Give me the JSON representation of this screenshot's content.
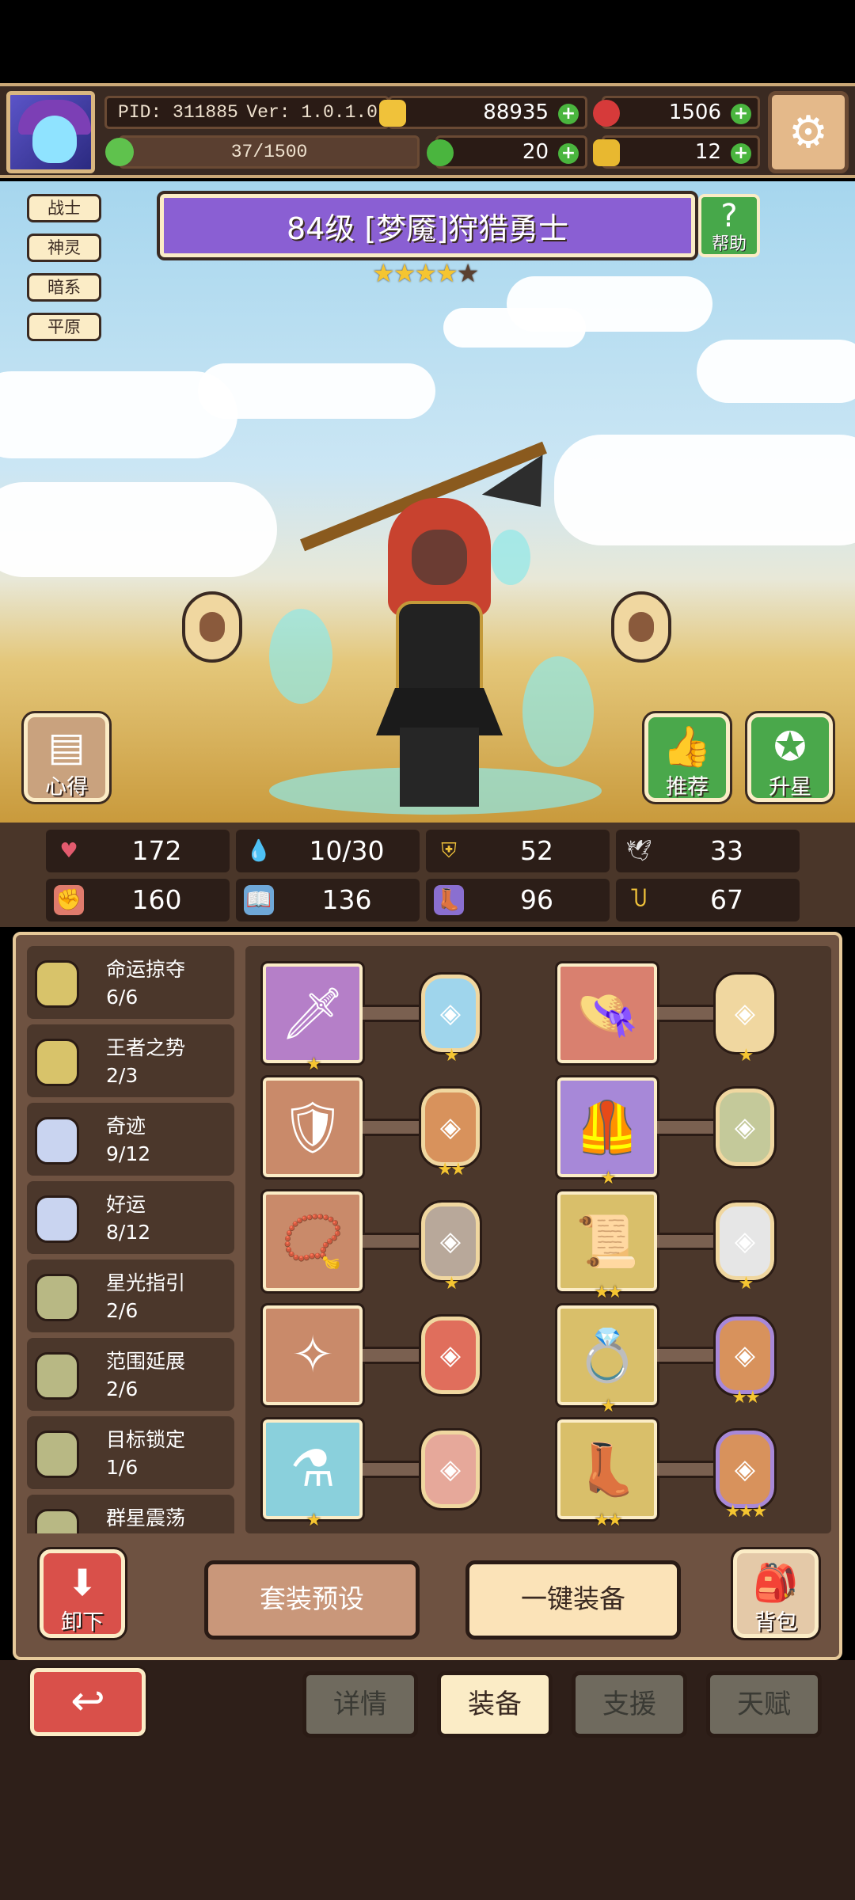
{
  "header": {
    "pid": "PID: 311885",
    "version": "Ver: 1.0.1.0",
    "gold": "88935",
    "gems": "1506",
    "stamina": "37/1500",
    "clover": "20",
    "cards": "12"
  },
  "hero": {
    "tags": [
      "战士",
      "神灵",
      "暗系",
      "平原"
    ],
    "title": "84级 [梦魇]狩猎勇士",
    "stars_filled": 4,
    "stars_total": 5,
    "help_label": "帮助",
    "insight_label": "心得",
    "recommend_label": "推荐",
    "starup_label": "升星"
  },
  "stats": [
    "172",
    "10/30",
    "52",
    "33",
    "160",
    "136",
    "96",
    "67"
  ],
  "sets": [
    {
      "name": "命运掠夺",
      "progress": "6/6",
      "color": "#d8c36a"
    },
    {
      "name": "王者之势",
      "progress": "2/3",
      "color": "#d8c36a"
    },
    {
      "name": "奇迹",
      "progress": "9/12",
      "color": "#c9d4f0"
    },
    {
      "name": "好运",
      "progress": "8/12",
      "color": "#c9d4f0"
    },
    {
      "name": "星光指引",
      "progress": "2/6",
      "color": "#b8b884"
    },
    {
      "name": "范围延展",
      "progress": "2/6",
      "color": "#b8b884"
    },
    {
      "name": "目标锁定",
      "progress": "1/6",
      "color": "#b8b884"
    },
    {
      "name": "群星震荡",
      "progress": "",
      "color": "#b8b884"
    }
  ],
  "actions": {
    "unequip": "卸下",
    "preset": "套装预设",
    "equip_all": "一键装备",
    "backpack": "背包"
  },
  "tabs": {
    "details": "详情",
    "equipment": "装备",
    "support": "支援",
    "talent": "天赋"
  },
  "colors": {
    "accent_green": "#4ab53e",
    "title_purple": "#8a5fd3",
    "back_red": "#d9504a",
    "panel_brown": "#6e5241"
  }
}
